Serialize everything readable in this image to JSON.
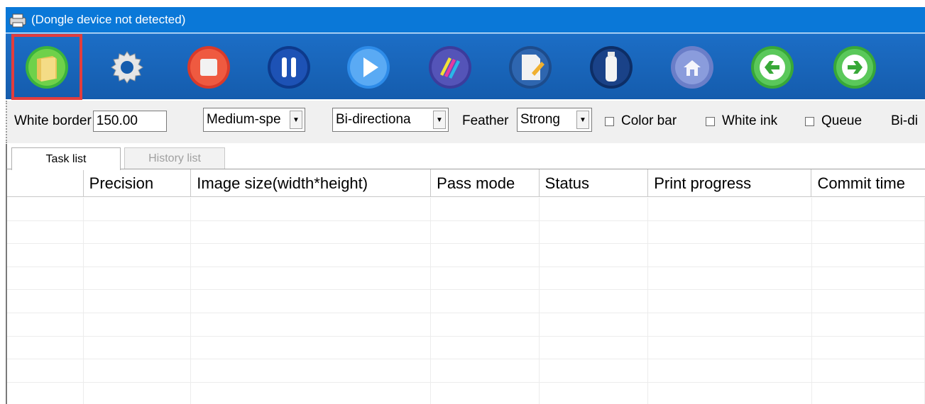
{
  "window": {
    "title": "(Dongle device not detected)"
  },
  "toolbar": {
    "buttons": [
      {
        "name": "open-file",
        "icon": "folder-icon"
      },
      {
        "name": "settings",
        "icon": "gear-icon"
      },
      {
        "name": "stop",
        "icon": "stop-icon"
      },
      {
        "name": "pause",
        "icon": "pause-icon"
      },
      {
        "name": "start",
        "icon": "play-icon"
      },
      {
        "name": "ink-colors",
        "icon": "ink-palette-icon"
      },
      {
        "name": "edit-document",
        "icon": "edit-document-icon"
      },
      {
        "name": "ink-bottle",
        "icon": "ink-bottle-icon"
      },
      {
        "name": "home",
        "icon": "home-icon"
      },
      {
        "name": "back",
        "icon": "arrow-left-icon"
      },
      {
        "name": "forward",
        "icon": "arrow-right-icon"
      }
    ],
    "highlight_color": "#e23d3d"
  },
  "options": {
    "white_border_label": "White border",
    "white_border_value": "150.00",
    "speed_value": "Medium-spe",
    "direction_value": "Bi-directiona",
    "feather_label": "Feather",
    "feather_value": "Strong",
    "color_bar_label": "Color bar",
    "white_ink_label": "White ink",
    "queue_label": "Queue",
    "bi_di_label": "Bi-di"
  },
  "tabs": {
    "task_list": "Task list",
    "history_list": "History list"
  },
  "grid": {
    "columns": [
      "",
      "Precision",
      "Image size(width*height)",
      "Pass mode",
      "Status",
      "Print progress",
      "Commit time"
    ],
    "rows": []
  },
  "colors": {
    "titlebar": "#0a78d8",
    "toolbar": "#155cad",
    "optionbar": "#f0f0f0"
  }
}
